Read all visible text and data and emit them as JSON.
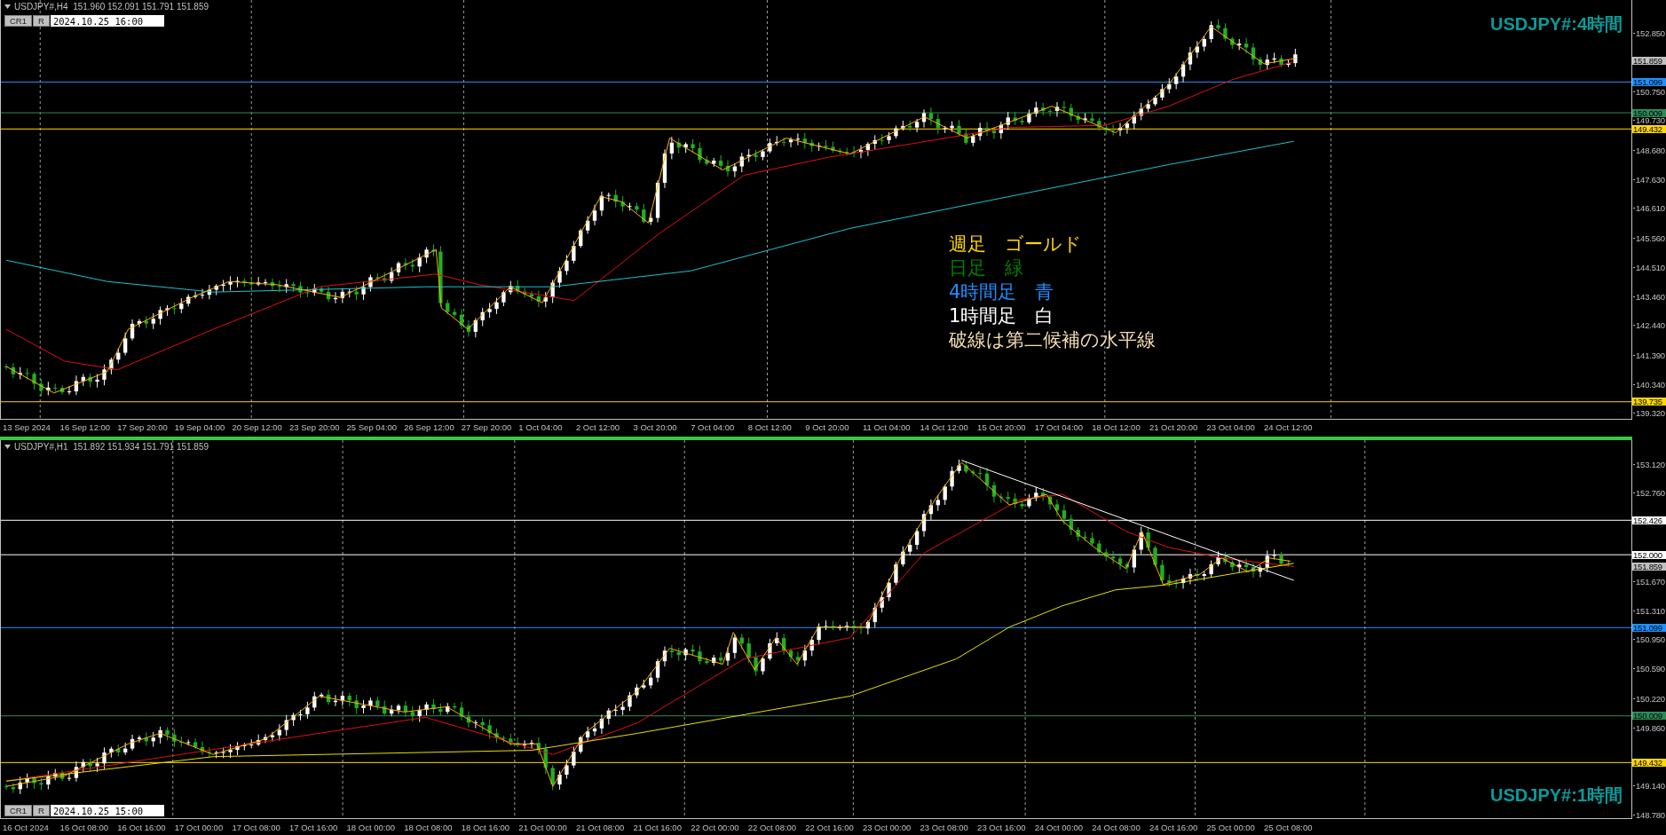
{
  "panels": [
    {
      "active": false,
      "symbol_info": "USDJPY#,H4  151.960 152.091 151.791 151.859",
      "toolbar": {
        "buttons": [
          "CR1",
          "R"
        ],
        "date": "2024.10.25 16:00"
      },
      "title": "USDJPY#:4時間",
      "price_ticks": [
        "152.850",
        "150.750",
        "149.730",
        "148.680",
        "147.630",
        "146.610",
        "145.560",
        "144.510",
        "143.460",
        "142.440",
        "141.390",
        "140.340",
        "139.320"
      ],
      "levels": [
        {
          "price": "151.859",
          "color": "#c0c0c0",
          "line": false
        },
        {
          "price": "151.099",
          "color": "#1e90ff",
          "line": true
        },
        {
          "price": "150.009",
          "color": "#2e8b57",
          "line": true
        },
        {
          "price": "149.432",
          "color": "#ffd700",
          "line": true
        },
        {
          "price": "139.735",
          "color": "#ffd700",
          "line": true
        }
      ],
      "time_labels": [
        "13 Sep 2024",
        "16 Sep 12:00",
        "17 Sep 20:00",
        "19 Sep 04:00",
        "20 Sep 12:00",
        "23 Sep 20:00",
        "25 Sep 04:00",
        "26 Sep 12:00",
        "27 Sep 20:00",
        "1 Oct 04:00",
        "2 Oct 12:00",
        "3 Oct 20:00",
        "7 Oct 04:00",
        "8 Oct 12:00",
        "9 Oct 20:00",
        "11 Oct 04:00",
        "14 Oct 12:00",
        "15 Oct 20:00",
        "17 Oct 04:00",
        "18 Oct 12:00",
        "21 Oct 20:00",
        "23 Oct 04:00",
        "24 Oct 12:00"
      ],
      "notes": [
        {
          "text": "週足　ゴールド",
          "color": "#ffd700"
        },
        {
          "text": "日足　緑",
          "color": "#008000"
        },
        {
          "text": "4時間足　青",
          "color": "#1e90ff"
        },
        {
          "text": "1時間足　白",
          "color": "#ffffff"
        },
        {
          "text": "破線は第二候補の水平線",
          "color": "#f5deb3"
        }
      ]
    },
    {
      "active": true,
      "symbol_info": "USDJPY#,H1  151.892 151.934 151.791 151.859",
      "toolbar": {
        "buttons": [
          "CR1",
          "R"
        ],
        "date": "2024.10.25 15:00"
      },
      "title": "USDJPY#:1時間",
      "price_ticks": [
        "153.120",
        "152.760",
        "151.670",
        "151.310",
        "150.950",
        "150.590",
        "150.220",
        "149.860",
        "149.140",
        "148.780"
      ],
      "levels": [
        {
          "price": "152.426",
          "color": "#ffffff",
          "line": true
        },
        {
          "price": "152.000",
          "color": "#ffffff",
          "line": true
        },
        {
          "price": "151.859",
          "color": "#c0c0c0",
          "line": false
        },
        {
          "price": "151.099",
          "color": "#1e90ff",
          "line": true
        },
        {
          "price": "150.009",
          "color": "#2e8b57",
          "line": true
        },
        {
          "price": "149.432",
          "color": "#ffd700",
          "line": true
        }
      ],
      "time_labels": [
        "16 Oct 2024",
        "16 Oct 08:00",
        "16 Oct 16:00",
        "17 Oct 00:00",
        "17 Oct 08:00",
        "17 Oct 16:00",
        "18 Oct 00:00",
        "18 Oct 08:00",
        "18 Oct 16:00",
        "21 Oct 00:00",
        "21 Oct 08:00",
        "21 Oct 16:00",
        "22 Oct 00:00",
        "22 Oct 08:00",
        "22 Oct 16:00",
        "23 Oct 00:00",
        "23 Oct 08:00",
        "23 Oct 16:00",
        "24 Oct 00:00",
        "24 Oct 08:00",
        "24 Oct 16:00",
        "25 Oct 00:00",
        "25 Oct 08:00"
      ]
    }
  ]
}
